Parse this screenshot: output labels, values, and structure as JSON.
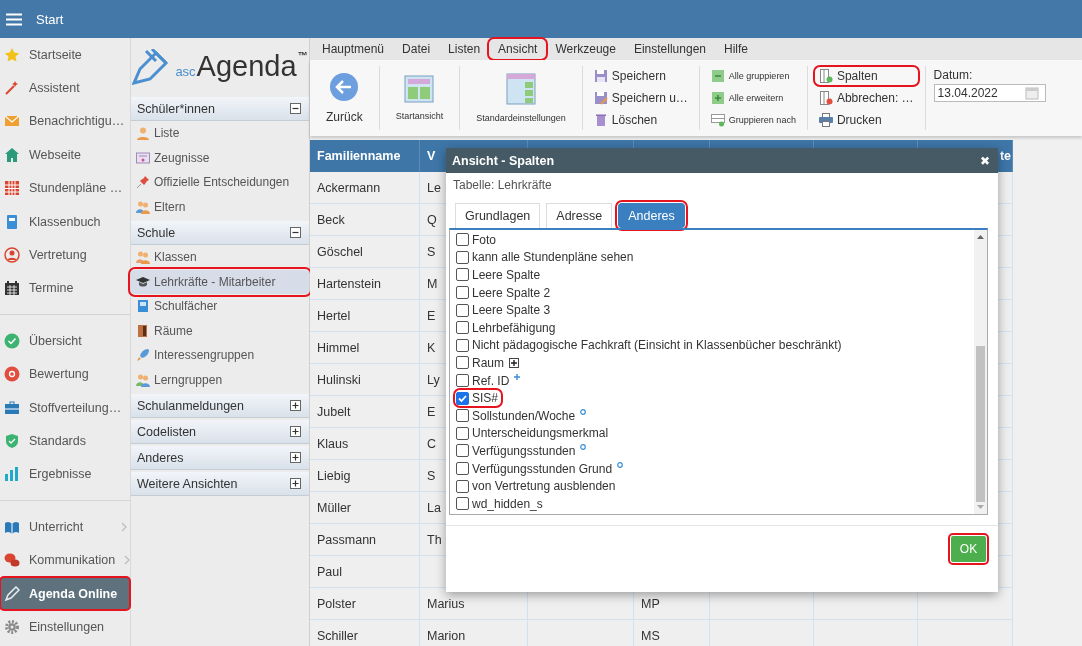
{
  "topbar": {
    "title": "Start"
  },
  "nav": {
    "groups": [
      [
        {
          "label": "Startseite",
          "selected": false,
          "submenu": false,
          "highlighted": false
        },
        {
          "label": "Assistent",
          "selected": false,
          "submenu": false,
          "highlighted": false
        },
        {
          "label": "Benachrichtigu…",
          "selected": false,
          "submenu": false,
          "highlighted": false
        },
        {
          "label": "Webseite",
          "selected": false,
          "submenu": false,
          "highlighted": false
        },
        {
          "label": "Stundenpläne …",
          "selected": false,
          "submenu": false,
          "highlighted": false
        },
        {
          "label": "Klassenbuch",
          "selected": false,
          "submenu": false,
          "highlighted": false
        },
        {
          "label": "Vertretung",
          "selected": false,
          "submenu": false,
          "highlighted": false
        },
        {
          "label": "Termine",
          "selected": false,
          "submenu": false,
          "highlighted": false
        }
      ],
      [
        {
          "label": "Übersicht",
          "selected": false,
          "submenu": false,
          "highlighted": false
        },
        {
          "label": "Bewertung",
          "selected": false,
          "submenu": false,
          "highlighted": false
        },
        {
          "label": "Stoffverteilung…",
          "selected": false,
          "submenu": false,
          "highlighted": false
        },
        {
          "label": "Standards",
          "selected": false,
          "submenu": false,
          "highlighted": false
        },
        {
          "label": "Ergebnisse",
          "selected": false,
          "submenu": false,
          "highlighted": false
        }
      ],
      [
        {
          "label": "Unterricht",
          "selected": false,
          "submenu": true,
          "highlighted": false
        },
        {
          "label": "Kommunikation",
          "selected": false,
          "submenu": true,
          "highlighted": false
        },
        {
          "label": "Agenda Online",
          "selected": true,
          "submenu": false,
          "highlighted": true
        },
        {
          "label": "Einstellungen",
          "selected": false,
          "submenu": false,
          "highlighted": false
        }
      ]
    ]
  },
  "logo": {
    "prefix": "asc",
    "name": "Agenda",
    "mark": "™"
  },
  "tree": {
    "sections": [
      {
        "label": "Schüler*innen",
        "expanded": true,
        "items": [
          {
            "label": "Liste",
            "selected": false,
            "highlighted": false
          },
          {
            "label": "Zeugnisse",
            "selected": false,
            "highlighted": false
          },
          {
            "label": "Offizielle Entscheidungen",
            "selected": false,
            "highlighted": false
          },
          {
            "label": "Eltern",
            "selected": false,
            "highlighted": false
          }
        ]
      },
      {
        "label": "Schule",
        "expanded": true,
        "items": [
          {
            "label": "Klassen",
            "selected": false,
            "highlighted": false
          },
          {
            "label": "Lehrkräfte - Mitarbeiter",
            "selected": true,
            "highlighted": true
          },
          {
            "label": "Schulfächer",
            "selected": false,
            "highlighted": false
          },
          {
            "label": "Räume",
            "selected": false,
            "highlighted": false
          },
          {
            "label": "Interessengruppen",
            "selected": false,
            "highlighted": false
          },
          {
            "label": "Lerngruppen",
            "selected": false,
            "highlighted": false
          }
        ]
      },
      {
        "label": "Schulanmeldungen",
        "expanded": false
      },
      {
        "label": "Codelisten",
        "expanded": false
      },
      {
        "label": "Anderes",
        "expanded": false
      },
      {
        "label": "Weitere Ansichten",
        "expanded": false
      }
    ]
  },
  "menubar": [
    {
      "label": "Hauptmenü",
      "highlighted": false
    },
    {
      "label": "Datei",
      "highlighted": false
    },
    {
      "label": "Listen",
      "highlighted": false
    },
    {
      "label": "Ansicht",
      "highlighted": true
    },
    {
      "label": "Werkzeuge",
      "highlighted": false
    },
    {
      "label": "Einstellungen",
      "highlighted": false
    },
    {
      "label": "Hilfe",
      "highlighted": false
    }
  ],
  "toolbar": {
    "large": [
      {
        "label": "Zurück",
        "kind": "normal"
      },
      {
        "label": "Startansicht",
        "kind": "tiny"
      },
      {
        "label": "Standardeinstellungen",
        "kind": "tiny"
      }
    ],
    "columns": [
      {
        "kind": "normal",
        "buttons": [
          {
            "label": "Speichern",
            "highlighted": false
          },
          {
            "label": "Speichern u…",
            "highlighted": false
          },
          {
            "label": "Löschen",
            "highlighted": false
          }
        ]
      },
      {
        "kind": "tiny",
        "buttons": [
          {
            "label": "Alle gruppieren",
            "highlighted": false
          },
          {
            "label": "Alle erweitern",
            "highlighted": false
          },
          {
            "label": "Gruppieren nach",
            "highlighted": false
          }
        ]
      },
      {
        "kind": "normal",
        "buttons": [
          {
            "label": "Spalten",
            "highlighted": true
          },
          {
            "label": "Abbrechen: …",
            "highlighted": false
          },
          {
            "label": "Drucken",
            "highlighted": false
          }
        ]
      }
    ],
    "date": {
      "label": "Datum:",
      "value": "13.04.2022"
    }
  },
  "table": {
    "columns": [
      "Familienname",
      "V",
      null,
      null,
      null,
      null,
      "te"
    ],
    "rows": [
      {
        "familienname": "Ackermann",
        "column_2": "Le"
      },
      {
        "familienname": "Beck",
        "column_2": "Q"
      },
      {
        "familienname": "Göschel",
        "column_2": "S"
      },
      {
        "familienname": "Hartenstein",
        "column_2": "M"
      },
      {
        "familienname": "Hertel",
        "column_2": "E"
      },
      {
        "familienname": "Himmel",
        "column_2": "K"
      },
      {
        "familienname": "Hulinski",
        "column_2": "Ly"
      },
      {
        "familienname": "Jubelt",
        "column_2": "E"
      },
      {
        "familienname": "Klaus",
        "column_2": "C"
      },
      {
        "familienname": "Liebig",
        "column_2": "S"
      },
      {
        "familienname": "Müller",
        "column_2": "La"
      },
      {
        "familienname": "Passmann",
        "column_2": "Th"
      },
      {
        "familienname": "Paul"
      },
      {
        "familienname": "Polster",
        "column_2": "Marius",
        "column_4": "MP"
      },
      {
        "familienname": "Schiller",
        "column_2": "Marion",
        "column_4": "MS"
      }
    ]
  },
  "dialog": {
    "title": "Ansicht - Spalten",
    "close": "✖",
    "subtitle": "Tabelle: Lehrkräfte",
    "tabs": [
      {
        "label": "Grundlagen",
        "selected": false,
        "highlighted": false
      },
      {
        "label": "Adresse",
        "selected": false,
        "highlighted": false
      },
      {
        "label": "Anderes",
        "selected": true,
        "highlighted": true
      }
    ],
    "options": [
      {
        "label": "Foto",
        "checked": false,
        "highlighted": false,
        "kind": "plain"
      },
      {
        "label": "kann alle Stundenpläne sehen",
        "checked": false,
        "highlighted": false,
        "kind": "plain"
      },
      {
        "label": "Leere Spalte",
        "checked": false,
        "highlighted": false,
        "kind": "plain"
      },
      {
        "label": "Leere Spalte 2",
        "checked": false,
        "highlighted": false,
        "kind": "plain"
      },
      {
        "label": "Leere Spalte 3",
        "checked": false,
        "highlighted": false,
        "kind": "plain"
      },
      {
        "label": "Lehrbefähigung",
        "checked": false,
        "highlighted": false,
        "kind": "plain"
      },
      {
        "label": "Nicht pädagogische Fachkraft (Einsicht in Klassenbücher beschränkt)",
        "checked": false,
        "highlighted": false,
        "kind": "plain"
      },
      {
        "label": "Raum",
        "checked": false,
        "highlighted": false,
        "kind": "expand"
      },
      {
        "label": "Ref. ID",
        "checked": false,
        "highlighted": false,
        "kind": "plus"
      },
      {
        "label": "SIS#",
        "checked": true,
        "highlighted": true,
        "kind": "plain"
      },
      {
        "label": "Sollstunden/Woche",
        "checked": false,
        "highlighted": false,
        "kind": "ring"
      },
      {
        "label": "Unterscheidungsmerkmal",
        "checked": false,
        "highlighted": false,
        "kind": "plain"
      },
      {
        "label": "Verfügungsstunden",
        "checked": false,
        "highlighted": false,
        "kind": "ring"
      },
      {
        "label": "Verfügungsstunden Grund",
        "checked": false,
        "highlighted": false,
        "kind": "ring"
      },
      {
        "label": "von Vertretung ausblenden",
        "checked": false,
        "highlighted": false,
        "kind": "plain"
      },
      {
        "label": "wd_hidden_s",
        "checked": false,
        "highlighted": false,
        "kind": "plain"
      }
    ],
    "ok": {
      "label": "OK",
      "highlighted": true
    }
  }
}
